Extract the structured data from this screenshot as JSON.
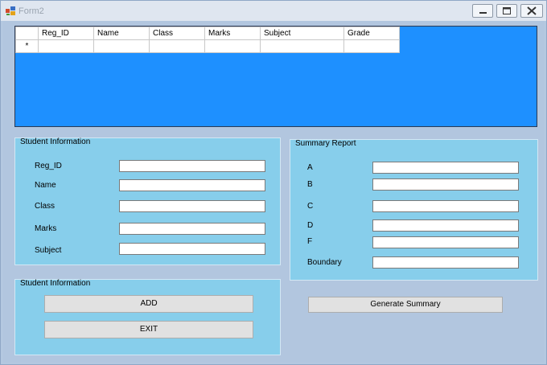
{
  "window": {
    "title": "Form2"
  },
  "grid": {
    "columns": [
      "Reg_ID",
      "Name",
      "Class",
      "Marks",
      "Subject",
      "Grade"
    ],
    "new_row_marker": "*"
  },
  "student_info": {
    "title": "Student Information",
    "fields": {
      "reg_id": {
        "label": "Reg_ID",
        "value": ""
      },
      "name": {
        "label": "Name",
        "value": ""
      },
      "class": {
        "label": "Class",
        "value": ""
      },
      "marks": {
        "label": "Marks",
        "value": ""
      },
      "subject": {
        "label": "Subject",
        "value": ""
      }
    }
  },
  "summary": {
    "title": "Summary Report",
    "fields": {
      "a": {
        "label": "A",
        "value": ""
      },
      "b": {
        "label": "B",
        "value": ""
      },
      "c": {
        "label": "C",
        "value": ""
      },
      "d": {
        "label": "D",
        "value": ""
      },
      "f": {
        "label": "F",
        "value": ""
      },
      "boundary": {
        "label": "Boundary",
        "value": ""
      }
    }
  },
  "actions": {
    "title": "Student Information",
    "add_label": "ADD",
    "exit_label": "EXIT",
    "generate_label": "Generate Summary"
  },
  "colors": {
    "grid_background": "#1e90ff",
    "group_background": "#87ceeb",
    "form_background": "#b2c6df"
  }
}
